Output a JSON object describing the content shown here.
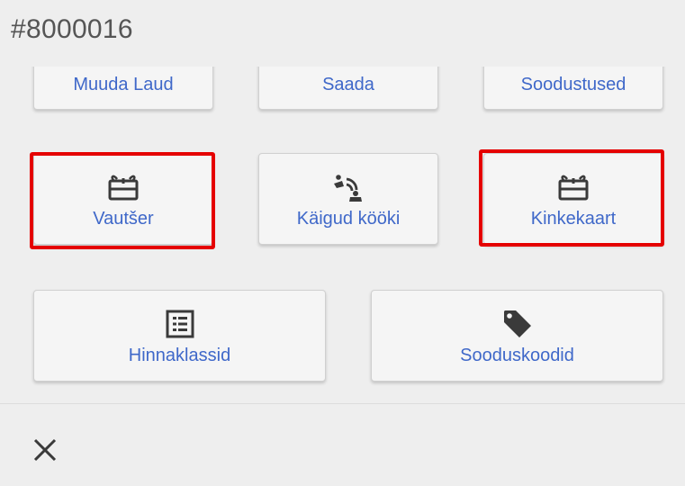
{
  "header": {
    "order_id": "#8000016"
  },
  "actions": {
    "muuda_laud": "Muuda Laud",
    "saada": "Saada",
    "soodustused": "Soodustused",
    "vautser": "Vautšer",
    "kaigud_kooki": "Käigud kööki",
    "kinkekaart": "Kinkekaart",
    "hinnaklassid": "Hinnaklassid",
    "sooduskoodid": "Sooduskoodid"
  },
  "icons": {
    "vautser": "gift-icon",
    "kaigud_kooki": "courses-to-kitchen-icon",
    "kinkekaart": "gift-icon",
    "hinnaklassid": "price-list-icon",
    "sooduskoodid": "tag-icon",
    "close": "close-icon"
  },
  "colors": {
    "label": "#3f68c9",
    "highlight": "#e50000",
    "background": "#eeeeee"
  }
}
